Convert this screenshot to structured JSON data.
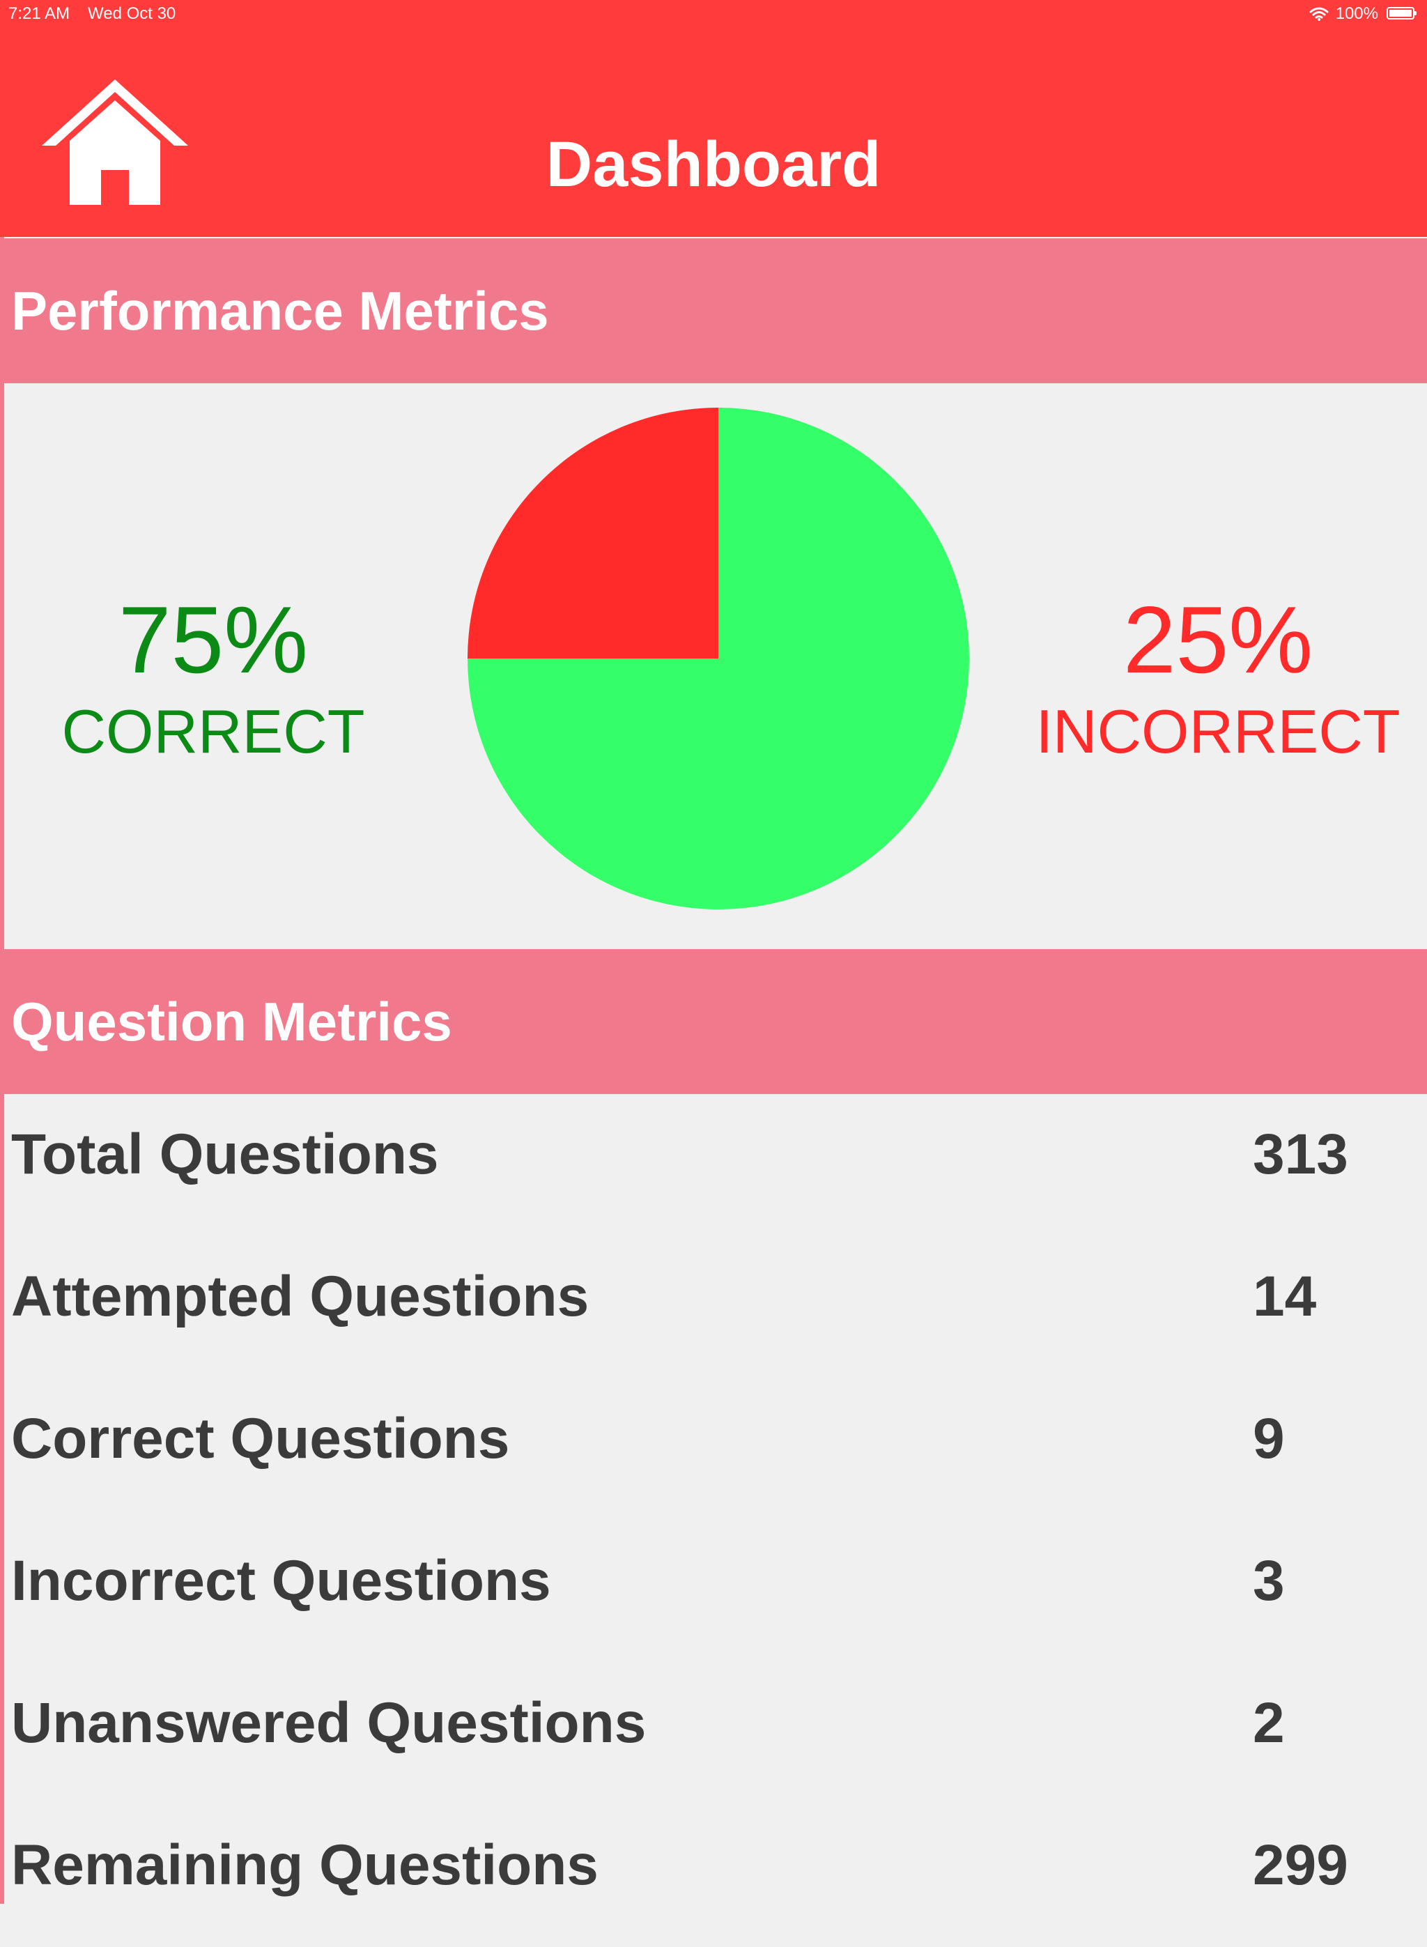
{
  "status_bar": {
    "time": "7:21 AM",
    "date": "Wed Oct 30",
    "battery": "100%"
  },
  "nav": {
    "title": "Dashboard",
    "home_icon": "home-icon"
  },
  "performance": {
    "title": "Performance Metrics",
    "correct_pct": "75%",
    "correct_label": "CORRECT",
    "incorrect_pct": "25%",
    "incorrect_label": "INCORRECT"
  },
  "chart_data": {
    "type": "pie",
    "values": [
      75,
      25
    ],
    "colors": [
      "#35ff68",
      "#ff2a2a"
    ]
  },
  "question_metrics": {
    "title": "Question Metrics",
    "rows": [
      {
        "label": "Total Questions",
        "value": "313"
      },
      {
        "label": "Attempted Questions",
        "value": "14"
      },
      {
        "label": "Correct Questions",
        "value": "9"
      },
      {
        "label": "Incorrect Questions",
        "value": "3"
      },
      {
        "label": "Unanswered Questions",
        "value": "2"
      },
      {
        "label": "Remaining Questions",
        "value": "299"
      }
    ]
  },
  "colors": {
    "brand_red": "#ff3b3b",
    "section_pink": "#f07a8c",
    "correct_green": "#0c8a16",
    "incorrect_red": "#ff2a2a",
    "background": "#f0f0f0"
  }
}
